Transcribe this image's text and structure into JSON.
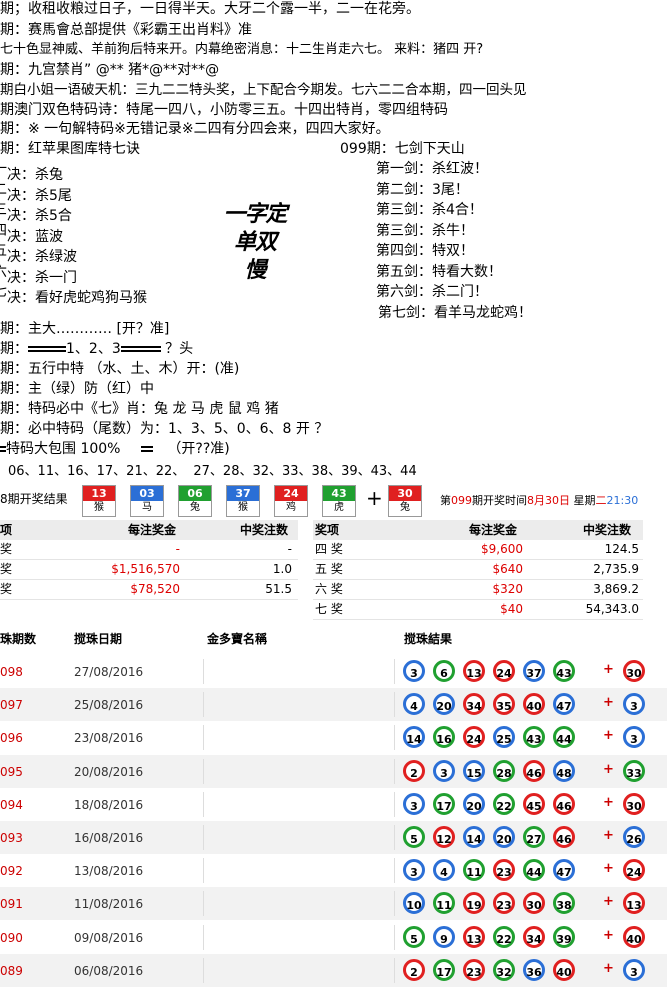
{
  "colors": {
    "red": "#e02020",
    "blue": "#2b6fd6",
    "green": "#20a030"
  },
  "lines": {
    "l1": "期；收租收粮过日子，一日得半天。大牙二个露一半，二一在花旁。",
    "l2": "期：赛馬會总部提供《彩霸王出肖料》准",
    "l3": "七十色显神威、羊前狗后特来开。内幕绝密消息：十二生肖走六七。  来料：猪四   开?",
    "l4": "期：九宫禁肖”  @** 猪*@**对**@",
    "l5": "期白小姐一语破天机：三九二二特头奖，上下配合今期发。七六二二合本期，四一回头见",
    "l6": "期澳门双色特码诗：特尾一四八，小防零三五。十四出特肖，零四组特码",
    "l7": "期：※ 一句解特码※无错记录※二四有分四会来，四四大家好。",
    "l8": "期：红苹果图库特七诀",
    "l8b": "099期：七剑下天山"
  },
  "jue": [
    "决：杀兔",
    "决：杀5尾",
    "决：杀5合",
    "决：蓝波",
    "决：杀绿波",
    "决：杀一门",
    "决：看好虎蛇鸡狗马猴"
  ],
  "jue_prefix": [
    "一",
    "二",
    "三",
    "四",
    "五",
    "六",
    "七"
  ],
  "jian": [
    "第一剑：杀红波！",
    "第二剑：3尾！",
    "第三剑：杀4合！",
    "第三剑：杀牛！",
    "第四剑：特双！",
    "第五剑：特看大数！",
    "第六剑：杀二门！",
    "第七剑：看羊马龙蛇鸡！"
  ],
  "handwritten": [
    "一字定单双",
    "慢"
  ],
  "extra": {
    "e1": "期：主大…………  [开？准]",
    "e2a": "期：",
    "e2b": "1、2、3",
    "e2c": " ？头",
    "e3": "期：五行中特   （水、土、木）开：(准)",
    "e4": "期：主（绿）防（红）中",
    "e5": "期：特码必中《七》肖：兔 龙 马 虎 鼠 鸡  猪",
    "e6": "期：必中特码（尾数）为：1、3、5、0、6、8      开 ？",
    "e7a": "特码大包围 100%",
    "e7b": "（开??准)",
    "nums": "06、11、16、17、21、22、 27、28、32、33、38、39、43、44"
  },
  "result": {
    "label": "8期开奖结果",
    "balls": [
      {
        "n": "13",
        "z": "猴",
        "c": "#e02020"
      },
      {
        "n": "03",
        "z": "马",
        "c": "#2b6fd6"
      },
      {
        "n": "06",
        "z": "兔",
        "c": "#20a030"
      },
      {
        "n": "37",
        "z": "猴",
        "c": "#2b6fd6"
      },
      {
        "n": "24",
        "z": "鸡",
        "c": "#e02020"
      },
      {
        "n": "43",
        "z": "虎",
        "c": "#20a030"
      }
    ],
    "special": {
      "n": "30",
      "z": "兔",
      "c": "#e02020"
    },
    "plus": "+",
    "info_a": "第",
    "info_period": "099",
    "info_b": "期开奖时间",
    "info_date": "8月30日",
    "info_c": " 星期",
    "info_day": "二",
    "info_time": "21:30"
  },
  "prize": {
    "left_hdr": [
      "项",
      "每注奖金",
      "中奖注数"
    ],
    "left_rows": [
      [
        "奖",
        "-",
        "-"
      ],
      [
        "奖",
        "$1,516,570",
        "1.0"
      ],
      [
        "奖",
        "$78,520",
        "51.5"
      ]
    ],
    "right_hdr": [
      "奖项",
      "每注奖金",
      "中奖注数"
    ],
    "right_rows": [
      [
        "四 奖",
        "$9,600",
        "124.5"
      ],
      [
        "五 奖",
        "$640",
        "2,735.9"
      ],
      [
        "六 奖",
        "$320",
        "3,869.2"
      ],
      [
        "七 奖",
        "$40",
        "54,343.0"
      ]
    ]
  },
  "history": {
    "hdr": [
      "珠期数",
      "搅珠日期",
      "金多寶名稱",
      "搅珠結果"
    ],
    "rows": [
      {
        "p": "098",
        "d": "27/08/2016",
        "b": [
          [
            "3",
            "b"
          ],
          [
            "6",
            "g"
          ],
          [
            "13",
            "r"
          ],
          [
            "24",
            "r"
          ],
          [
            "37",
            "b"
          ],
          [
            "43",
            "g"
          ]
        ],
        "s": [
          "30",
          "r"
        ]
      },
      {
        "p": "097",
        "d": "25/08/2016",
        "b": [
          [
            "4",
            "b"
          ],
          [
            "20",
            "b"
          ],
          [
            "34",
            "r"
          ],
          [
            "35",
            "r"
          ],
          [
            "40",
            "r"
          ],
          [
            "47",
            "b"
          ]
        ],
        "s": [
          "3",
          "b"
        ]
      },
      {
        "p": "096",
        "d": "23/08/2016",
        "b": [
          [
            "14",
            "b"
          ],
          [
            "16",
            "g"
          ],
          [
            "24",
            "r"
          ],
          [
            "25",
            "b"
          ],
          [
            "43",
            "g"
          ],
          [
            "44",
            "g"
          ]
        ],
        "s": [
          "3",
          "b"
        ]
      },
      {
        "p": "095",
        "d": "20/08/2016",
        "b": [
          [
            "2",
            "r"
          ],
          [
            "3",
            "b"
          ],
          [
            "15",
            "b"
          ],
          [
            "28",
            "g"
          ],
          [
            "46",
            "r"
          ],
          [
            "48",
            "b"
          ]
        ],
        "s": [
          "33",
          "g"
        ]
      },
      {
        "p": "094",
        "d": "18/08/2016",
        "b": [
          [
            "3",
            "b"
          ],
          [
            "17",
            "g"
          ],
          [
            "20",
            "b"
          ],
          [
            "22",
            "g"
          ],
          [
            "45",
            "r"
          ],
          [
            "46",
            "r"
          ]
        ],
        "s": [
          "30",
          "r"
        ]
      },
      {
        "p": "093",
        "d": "16/08/2016",
        "b": [
          [
            "5",
            "g"
          ],
          [
            "12",
            "r"
          ],
          [
            "14",
            "b"
          ],
          [
            "20",
            "b"
          ],
          [
            "27",
            "g"
          ],
          [
            "46",
            "r"
          ]
        ],
        "s": [
          "26",
          "b"
        ]
      },
      {
        "p": "092",
        "d": "13/08/2016",
        "b": [
          [
            "3",
            "b"
          ],
          [
            "4",
            "b"
          ],
          [
            "11",
            "g"
          ],
          [
            "23",
            "r"
          ],
          [
            "44",
            "g"
          ],
          [
            "47",
            "b"
          ]
        ],
        "s": [
          "24",
          "r"
        ]
      },
      {
        "p": "091",
        "d": "11/08/2016",
        "b": [
          [
            "10",
            "b"
          ],
          [
            "11",
            "g"
          ],
          [
            "19",
            "r"
          ],
          [
            "23",
            "r"
          ],
          [
            "30",
            "r"
          ],
          [
            "38",
            "g"
          ]
        ],
        "s": [
          "13",
          "r"
        ]
      },
      {
        "p": "090",
        "d": "09/08/2016",
        "b": [
          [
            "5",
            "g"
          ],
          [
            "9",
            "b"
          ],
          [
            "13",
            "r"
          ],
          [
            "22",
            "g"
          ],
          [
            "34",
            "r"
          ],
          [
            "39",
            "g"
          ]
        ],
        "s": [
          "40",
          "r"
        ]
      },
      {
        "p": "089",
        "d": "06/08/2016",
        "b": [
          [
            "2",
            "r"
          ],
          [
            "17",
            "g"
          ],
          [
            "23",
            "r"
          ],
          [
            "32",
            "g"
          ],
          [
            "36",
            "b"
          ],
          [
            "40",
            "r"
          ]
        ],
        "s": [
          "3",
          "b"
        ]
      }
    ]
  }
}
